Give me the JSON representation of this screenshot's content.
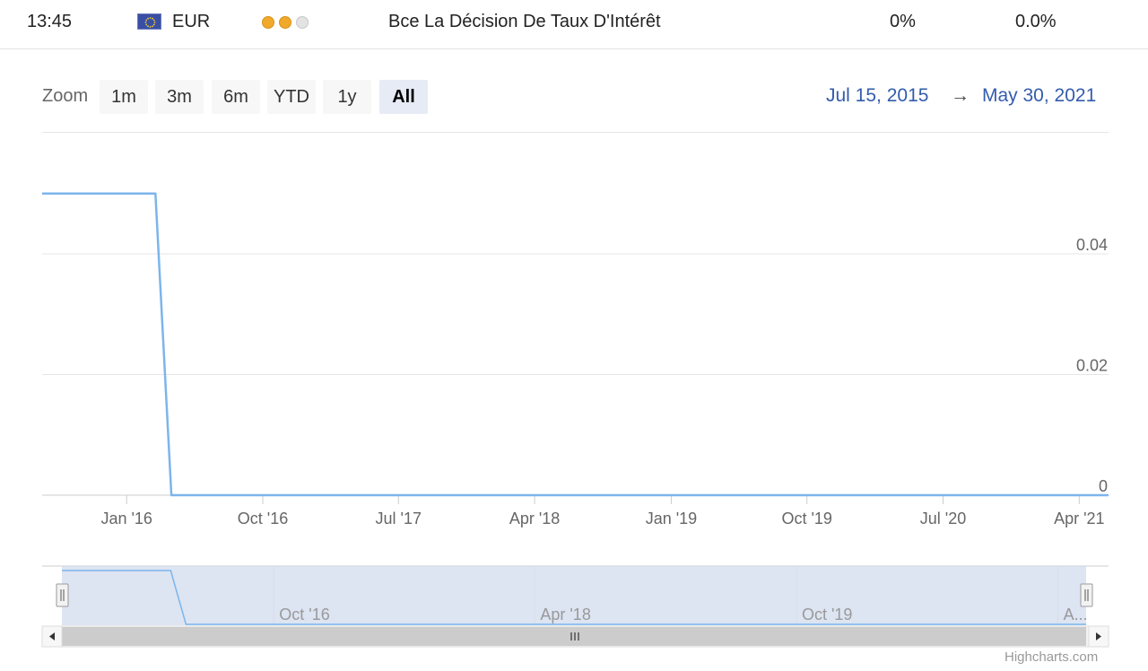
{
  "event_row": {
    "time": "13:45",
    "currency": "EUR",
    "flag_icon": "eu-flag-icon",
    "importance": {
      "level": 2,
      "max": 3
    },
    "event": "Bce La Décision De Taux D'Intérêt",
    "actual": "0%",
    "previous": "0.0%"
  },
  "zoom": {
    "label": "Zoom",
    "buttons": [
      "1m",
      "3m",
      "6m",
      "YTD",
      "1y",
      "All"
    ],
    "active": "All"
  },
  "range": {
    "from": "Jul 15, 2015",
    "arrow": "→",
    "to": "May 30, 2021"
  },
  "colors": {
    "series": "#7cb5ec",
    "navigator_mask": "#d2dbee",
    "accent": "#335cad"
  },
  "chart_data": {
    "type": "line",
    "x_type": "datetime",
    "x_range": [
      "2015-07-15",
      "2021-05-30"
    ],
    "x_ticks": [
      {
        "date": "2016-01-01",
        "label": "Jan '16"
      },
      {
        "date": "2016-10-01",
        "label": "Oct '16"
      },
      {
        "date": "2017-07-01",
        "label": "Jul '17"
      },
      {
        "date": "2018-04-01",
        "label": "Apr '18"
      },
      {
        "date": "2019-01-01",
        "label": "Jan '19"
      },
      {
        "date": "2019-10-01",
        "label": "Oct '19"
      },
      {
        "date": "2020-07-01",
        "label": "Jul '20"
      },
      {
        "date": "2021-04-01",
        "label": "Apr '21"
      }
    ],
    "y_ticks": [
      0,
      0.02,
      0.04
    ],
    "ylim": [
      0,
      0.06
    ],
    "grid": true,
    "series": [
      {
        "points": [
          {
            "x": "2015-07-15",
            "y": 0.05
          },
          {
            "x": "2016-02-28",
            "y": 0.05
          },
          {
            "x": "2016-03-31",
            "y": 0
          },
          {
            "x": "2021-05-30",
            "y": 0
          }
        ]
      }
    ],
    "navigator": {
      "x_range": [
        "2015-07-15",
        "2021-05-30"
      ],
      "ticks": [
        {
          "date": "2016-10-01",
          "label": "Oct '16"
        },
        {
          "date": "2018-04-01",
          "label": "Apr '18"
        },
        {
          "date": "2019-10-01",
          "label": "Oct '19"
        },
        {
          "date": "2021-04-01",
          "label": "A..."
        }
      ],
      "selected": [
        "2015-07-15",
        "2021-05-30"
      ]
    },
    "credit": "Highcharts.com"
  }
}
